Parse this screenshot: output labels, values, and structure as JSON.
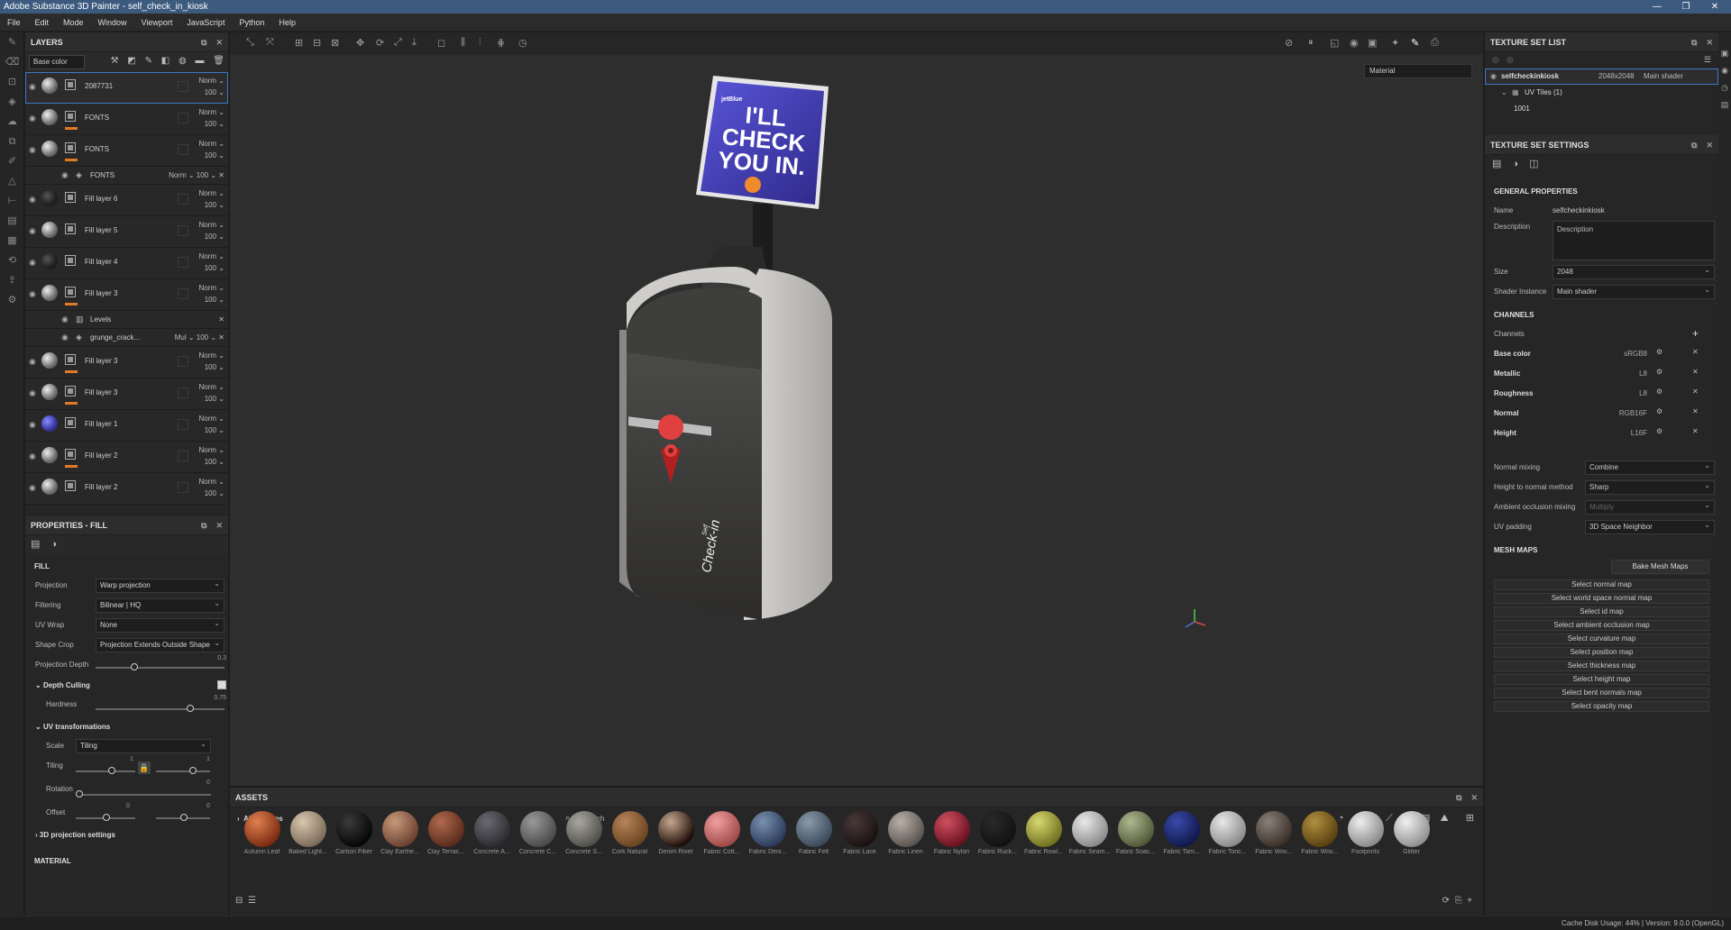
{
  "window": {
    "title": "Adobe Substance 3D Painter - self_check_in_kiosk"
  },
  "menu": [
    "File",
    "Edit",
    "Mode",
    "Window",
    "Viewport",
    "JavaScript",
    "Python",
    "Help"
  ],
  "layers": {
    "title": "LAYERS",
    "channel_select": "Base color",
    "rows": [
      {
        "name": "2087731",
        "blend": "Norm",
        "opacity": "100",
        "thumb": "light",
        "active": true
      },
      {
        "name": "FONTS",
        "blend": "Norm",
        "opacity": "100",
        "thumb": "light",
        "orange": true
      },
      {
        "name": "FONTS",
        "blend": "Norm",
        "opacity": "100",
        "thumb": "light",
        "orange": true
      },
      {
        "name": "FONTS",
        "blend": "Norm",
        "opacity": "100",
        "sub": true
      },
      {
        "name": "Fill layer 6",
        "blend": "Norm",
        "opacity": "100",
        "thumb": "dark"
      },
      {
        "name": "Fill layer 5",
        "blend": "Norm",
        "opacity": "100",
        "thumb": "light"
      },
      {
        "name": "Fill layer 4",
        "blend": "Norm",
        "opacity": "100",
        "thumb": "dark"
      },
      {
        "name": "Fill layer 3",
        "blend": "Norm",
        "opacity": "100",
        "thumb": "light",
        "orange": true
      },
      {
        "name": "Levels",
        "sub": true,
        "blend": "",
        "opacity": ""
      },
      {
        "name": "grunge_crack...",
        "blend": "Mul",
        "opacity": "100",
        "sub": true
      },
      {
        "name": "Fill layer 3",
        "blend": "Norm",
        "opacity": "100",
        "thumb": "light",
        "orange": true
      },
      {
        "name": "Fill layer 3",
        "blend": "Norm",
        "opacity": "100",
        "thumb": "light",
        "orange": true
      },
      {
        "name": "Fill layer 1",
        "blend": "Norm",
        "opacity": "100",
        "thumb": "blue"
      },
      {
        "name": "Fill layer 2",
        "blend": "Norm",
        "opacity": "100",
        "thumb": "light",
        "orange": true
      },
      {
        "name": "Fill layer 2",
        "blend": "Norm",
        "opacity": "100",
        "thumb": "light"
      }
    ]
  },
  "properties": {
    "title": "PROPERTIES - FILL",
    "section": "FILL",
    "projection_label": "Projection",
    "projection": "Warp projection",
    "filtering_label": "Filtering",
    "filtering": "Bilinear | HQ",
    "uvwrap_label": "UV Wrap",
    "uvwrap": "None",
    "shapecrop_label": "Shape Crop",
    "shapecrop": "Projection Extends Outside Shape",
    "projdepth_label": "Projection Depth",
    "projdepth_value": "0.3",
    "depthculling": "Depth Culling",
    "hardness_label": "Hardness",
    "hardness_value": "0.75",
    "uvtrans": "UV transformations",
    "scale_label": "Scale",
    "scale": "Tiling",
    "tiling_label": "Tiling",
    "tiling_value": "1",
    "tiling_value2": "1",
    "rotation_label": "Rotation",
    "rotation_value": "0",
    "offset_label": "Offset",
    "offset_value": "0",
    "offset_value2": "0",
    "proj3d": "3D projection settings",
    "material": "MATERIAL"
  },
  "viewport": {
    "material_mode": "Material"
  },
  "kiosk": {
    "brand": "jetBlue",
    "line1": "I'LL",
    "line2": "CHECK",
    "line3": "YOU IN.",
    "side_small": "Self",
    "side_big": "Check-in"
  },
  "assets": {
    "title": "ASSETS",
    "library": "All libraries",
    "search_placeholder": "Search",
    "items": [
      {
        "name": "Autumn Leaf",
        "c1": "#e08050",
        "c2": "#7a2a10"
      },
      {
        "name": "Baked Light...",
        "c1": "#d8c8b0",
        "c2": "#7a6a58"
      },
      {
        "name": "Carbon Fiber",
        "c1": "#3a3a3a",
        "c2": "#050505"
      },
      {
        "name": "Clay Earthe...",
        "c1": "#c89a7a",
        "c2": "#6a4030"
      },
      {
        "name": "Clay Terrac...",
        "c1": "#b06a50",
        "c2": "#5a2a1a"
      },
      {
        "name": "Concrete A...",
        "c1": "#6a6a70",
        "c2": "#2a2a30"
      },
      {
        "name": "Concrete C...",
        "c1": "#9a9a9a",
        "c2": "#4a4a4a"
      },
      {
        "name": "Concrete S...",
        "c1": "#a8a8a0",
        "c2": "#505048"
      },
      {
        "name": "Cork Natural",
        "c1": "#b8845a",
        "c2": "#6a4420"
      },
      {
        "name": "Denim Rivet",
        "c1": "#c8a890",
        "c2": "#1a0a05"
      },
      {
        "name": "Fabric Cott...",
        "c1": "#f0a0a0",
        "c2": "#a04848"
      },
      {
        "name": "Fabric Deni...",
        "c1": "#7a90b0",
        "c2": "#2a3a58"
      },
      {
        "name": "Fabric Felt",
        "c1": "#8a9aaa",
        "c2": "#3a4a5a"
      },
      {
        "name": "Fabric Lace",
        "c1": "#4a3a3a",
        "c2": "#1a1010"
      },
      {
        "name": "Fabric Linen",
        "c1": "#bab0a8",
        "c2": "#5a5450"
      },
      {
        "name": "Fabric Nylon",
        "c1": "#d05060",
        "c2": "#6a1020"
      },
      {
        "name": "Fabric Ruck...",
        "c1": "#2a2a2a",
        "c2": "#111111"
      },
      {
        "name": "Fabric Rowl...",
        "c1": "#d8d870",
        "c2": "#707020"
      },
      {
        "name": "Fabric Seam...",
        "c1": "#eaeaea",
        "c2": "#8a8a8a"
      },
      {
        "name": "Fabric Soac...",
        "c1": "#b0b890",
        "c2": "#505838"
      },
      {
        "name": "Fabric Tam...",
        "c1": "#3a4aaa",
        "c2": "#10184a"
      },
      {
        "name": "Fabric Tonc...",
        "c1": "#e8e8e8",
        "c2": "#8a8a8a"
      },
      {
        "name": "Fabric Wov...",
        "c1": "#8a8078",
        "c2": "#3a3028"
      },
      {
        "name": "Fabric Wov...",
        "c1": "#b09040",
        "c2": "#5a4010"
      },
      {
        "name": "Footprints",
        "c1": "#eeeeee",
        "c2": "#8a8a8a"
      },
      {
        "name": "Glitter",
        "c1": "#f0f0f0",
        "c2": "#909090"
      }
    ]
  },
  "texture_set_list": {
    "title": "TEXTURE SET LIST",
    "name": "selfcheckinkiosk",
    "size": "2048x2048",
    "shader": "Main shader",
    "uvtiles": "UV Tiles (1)",
    "tile": "1001"
  },
  "texture_set_settings": {
    "title": "TEXTURE SET SETTINGS",
    "general": "GENERAL PROPERTIES",
    "name_label": "Name",
    "name": "selfcheckinkiosk",
    "desc_label": "Description",
    "desc_placeholder": "Description",
    "size_label": "Size",
    "size": "2048",
    "shader_label": "Shader Instance",
    "shader": "Main shader",
    "channels_title": "CHANNELS",
    "channels_label": "Channels",
    "channels": [
      {
        "name": "Base color",
        "format": "sRGB8"
      },
      {
        "name": "Metallic",
        "format": "L8"
      },
      {
        "name": "Roughness",
        "format": "L8"
      },
      {
        "name": "Normal",
        "format": "RGB16F"
      },
      {
        "name": "Height",
        "format": "L16F"
      }
    ],
    "normal_mixing_label": "Normal mixing",
    "normal_mixing": "Combine",
    "htn_label": "Height to normal method",
    "htn": "Sharp",
    "ao_label": "Ambient occlusion mixing",
    "ao": "Multiply",
    "uvpad_label": "UV padding",
    "uvpad": "3D Space Neighbor",
    "meshmaps_title": "MESH MAPS",
    "bake": "Bake Mesh Maps",
    "maps": [
      "Select normal map",
      "Select world space normal map",
      "Select id map",
      "Select ambient occlusion map",
      "Select curvature map",
      "Select position map",
      "Select thickness map",
      "Select height map",
      "Select bent normals map",
      "Select opacity map"
    ]
  },
  "status": {
    "text": "Cache Disk Usage:    44%  |  Version: 9.0.0 (OpenGL)"
  }
}
